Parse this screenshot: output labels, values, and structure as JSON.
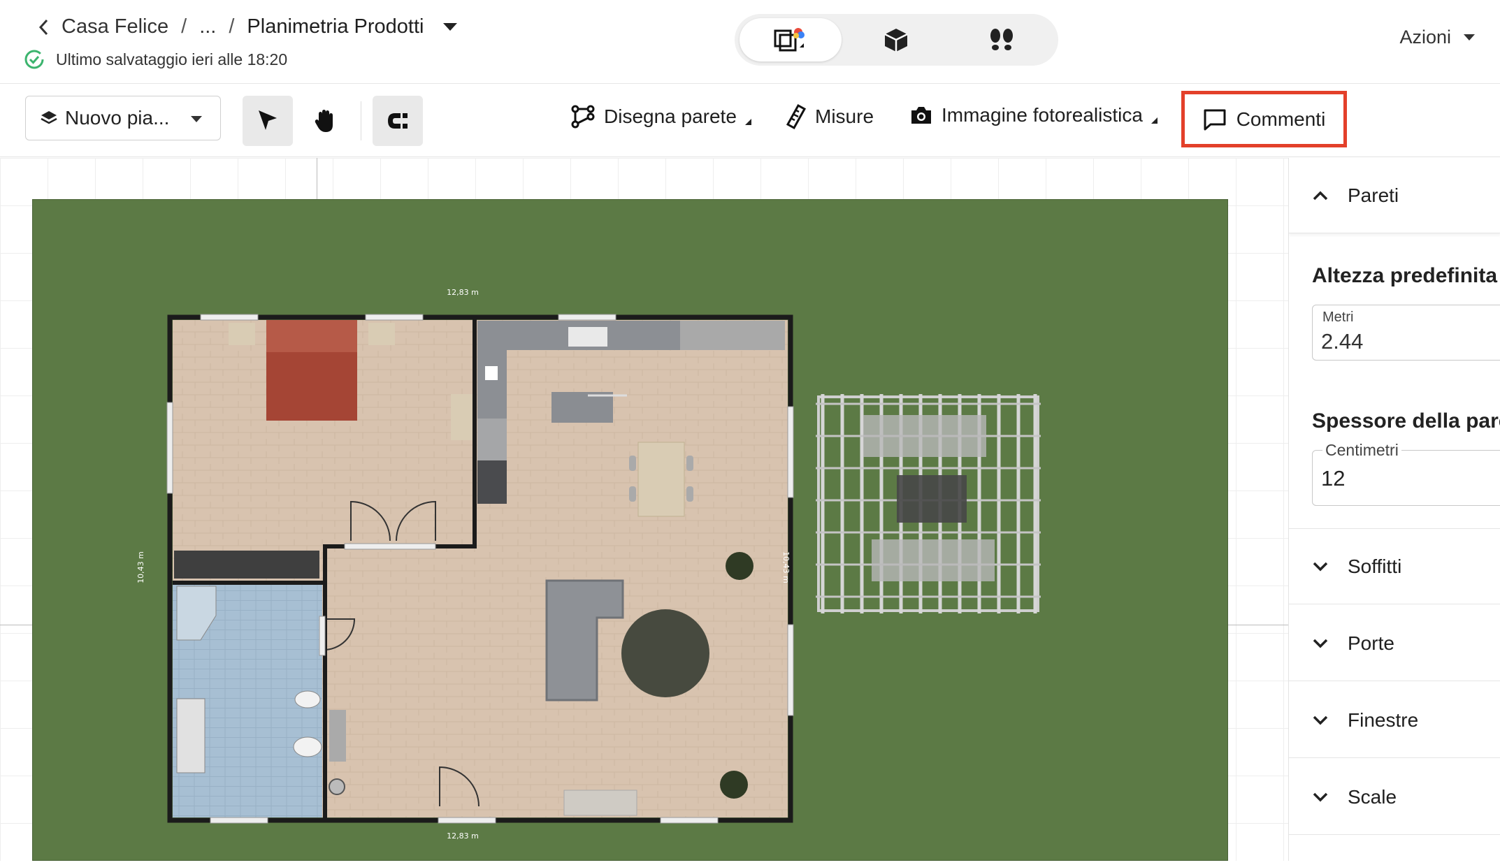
{
  "header": {
    "breadcrumb": {
      "project": "Casa Felice",
      "ellipsis": "...",
      "current": "Planimetria Prodotti"
    },
    "save_status": "Ultimo salvataggio ieri alle 18:20",
    "views": [
      {
        "name": "2d-plan",
        "icon": "plan-2d-icon",
        "active": true
      },
      {
        "name": "3d-box",
        "icon": "cube-3d-icon",
        "active": false
      },
      {
        "name": "walk",
        "icon": "footsteps-icon",
        "active": false
      }
    ],
    "actions_label": "Azioni"
  },
  "toolbar": {
    "floor_label": "Nuovo pia...",
    "draw_wall": "Disegna parete",
    "measures": "Misure",
    "photoreal": "Immagine fotorealistica",
    "comments": "Commenti"
  },
  "plan": {
    "dims": {
      "top": "12,83 m",
      "bottom": "12,83 m",
      "left": "10,43 m",
      "right": "10,43 m"
    },
    "colors": {
      "grass": "#5c7a45",
      "floor": "#d8c3af",
      "wall": "#1b1b1b",
      "bed": "#a54535",
      "bath": "#a7bfd3"
    }
  },
  "panel": {
    "pareti": "Pareti",
    "default_height_title": "Altezza predefinita",
    "height_unit": "Metri",
    "height_value": "2.44",
    "wall_thickness_title": "Spessore della parete",
    "thickness_unit": "Centimetri",
    "thickness_value": "12",
    "soffitti": "Soffitti",
    "porte": "Porte",
    "finestre": "Finestre",
    "scale": "Scale"
  }
}
